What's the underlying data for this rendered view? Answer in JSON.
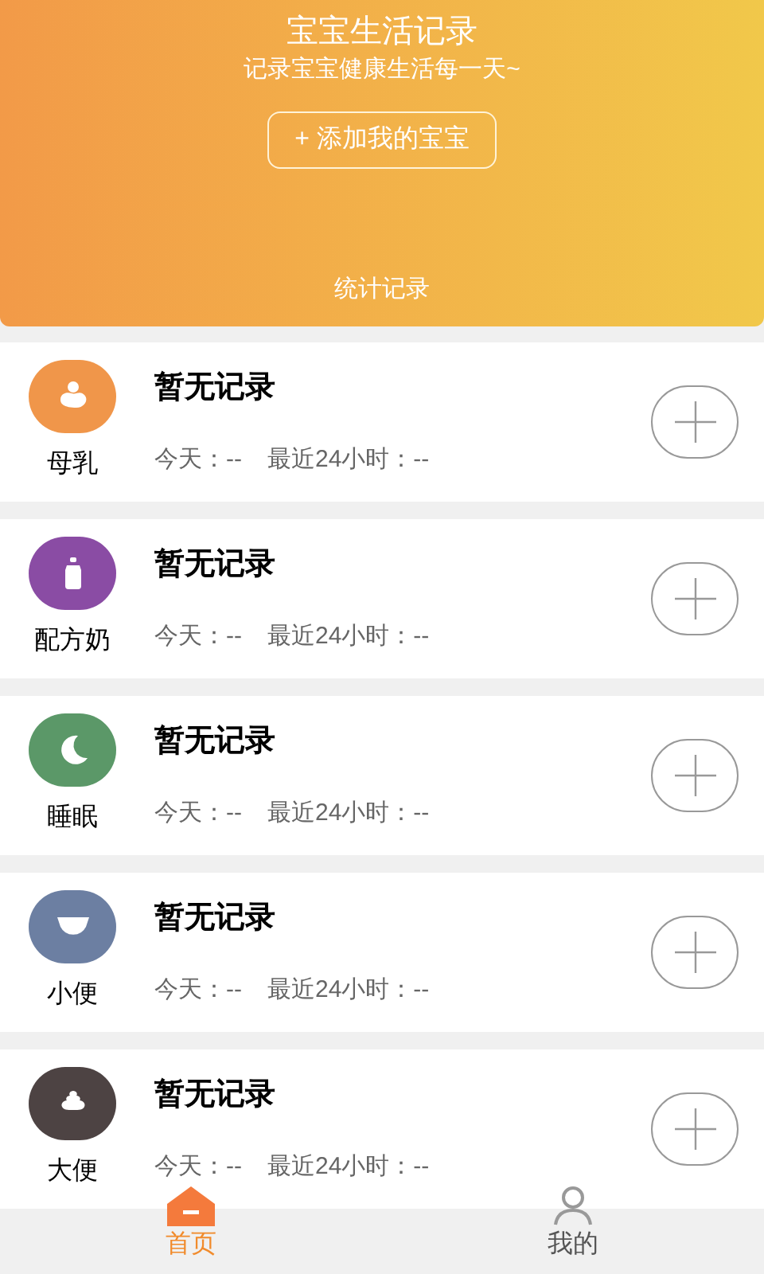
{
  "header": {
    "title": "宝宝生活记录",
    "subtitle": "记录宝宝健康生活每一天~",
    "add_button": "+ 添加我的宝宝",
    "stats_link": "统计记录"
  },
  "records": [
    {
      "kind": "breastfeeding",
      "label": "母乳",
      "color": "#f0964a",
      "status": "暂无记录",
      "today": "今天：--",
      "last_24h": "最近24小时：--"
    },
    {
      "kind": "bottle",
      "label": "配方奶",
      "color": "#8a4ca4",
      "status": "暂无记录",
      "today": "今天：--",
      "last_24h": "最近24小时：--"
    },
    {
      "kind": "sleep",
      "label": "睡眠",
      "color": "#5b9868",
      "status": "暂无记录",
      "today": "今天：--",
      "last_24h": "最近24小时：--"
    },
    {
      "kind": "diaper",
      "label": "小便",
      "color": "#6c7fa2",
      "status": "暂无记录",
      "today": "今天：--",
      "last_24h": "最近24小时：--"
    },
    {
      "kind": "poop",
      "label": "大便",
      "color": "#4d4343",
      "status": "暂无记录",
      "today": "今天：--",
      "last_24h": "最近24小时：--"
    }
  ],
  "tab_bar": [
    {
      "kind": "home",
      "label": "首页",
      "selected": true
    },
    {
      "kind": "profile",
      "label": "我的",
      "selected": false
    }
  ]
}
